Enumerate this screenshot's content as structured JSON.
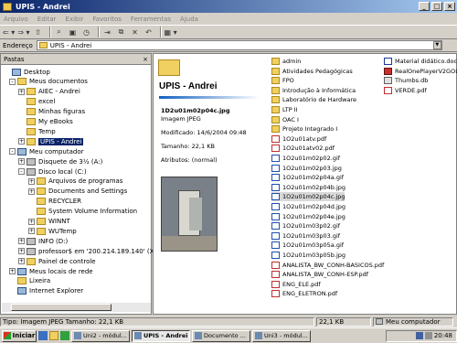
{
  "window": {
    "title": "UPIS - Andrei"
  },
  "menu": [
    "Arquivo",
    "Editar",
    "Exibir",
    "Favoritos",
    "Ferramentas",
    "Ajuda"
  ],
  "address": {
    "label": "Endereço",
    "value": "UPIS - Andrei"
  },
  "folders_pane": {
    "title": "Pastas",
    "close": "×"
  },
  "tree": [
    {
      "label": "Desktop",
      "icon": "desktop-icon",
      "level": 0,
      "expand": ""
    },
    {
      "label": "Meus documentos",
      "icon": "folder-icon",
      "level": 1,
      "expand": "-"
    },
    {
      "label": "AIEC - Andrei",
      "icon": "folder-icon",
      "level": 2,
      "expand": "+"
    },
    {
      "label": "excel",
      "icon": "folder-icon",
      "level": 2,
      "expand": ""
    },
    {
      "label": "Minhas figuras",
      "icon": "folder-icon",
      "level": 2,
      "expand": ""
    },
    {
      "label": "My eBooks",
      "icon": "folder-icon",
      "level": 2,
      "expand": ""
    },
    {
      "label": "Temp",
      "icon": "folder-icon",
      "level": 2,
      "expand": ""
    },
    {
      "label": "UPIS - Andrei",
      "icon": "folder-icon",
      "level": 2,
      "expand": "+",
      "selected": true
    },
    {
      "label": "Meu computador",
      "icon": "computer-icon",
      "level": 1,
      "expand": "-"
    },
    {
      "label": "Disquete de 3½ (A:)",
      "icon": "drive-icon",
      "level": 2,
      "expand": "+"
    },
    {
      "label": "Disco local (C:)",
      "icon": "drive-icon",
      "level": 2,
      "expand": "-"
    },
    {
      "label": "Arquivos de programas",
      "icon": "folder-icon",
      "level": 3,
      "expand": "+"
    },
    {
      "label": "Documents and Settings",
      "icon": "folder-icon",
      "level": 3,
      "expand": "+"
    },
    {
      "label": "RECYCLER",
      "icon": "folder-icon",
      "level": 3,
      "expand": ""
    },
    {
      "label": "System Volume Information",
      "icon": "folder-icon",
      "level": 3,
      "expand": ""
    },
    {
      "label": "WINNT",
      "icon": "folder-icon",
      "level": 3,
      "expand": "+"
    },
    {
      "label": "WUTemp",
      "icon": "folder-icon",
      "level": 3,
      "expand": "+"
    },
    {
      "label": "INFO (D:)",
      "icon": "drive-icon",
      "level": 2,
      "expand": "+"
    },
    {
      "label": "professor$ em '200.214.189.140' (X:)",
      "icon": "drive-icon",
      "level": 2,
      "expand": "+"
    },
    {
      "label": "Painel de controle",
      "icon": "folder-icon",
      "level": 2,
      "expand": "+"
    },
    {
      "label": "Meus locais de rede",
      "icon": "computer-icon",
      "level": 1,
      "expand": "+"
    },
    {
      "label": "Lixeira",
      "icon": "folder-icon",
      "level": 1,
      "expand": ""
    },
    {
      "label": "Internet Explorer",
      "icon": "computer-icon",
      "level": 1,
      "expand": ""
    }
  ],
  "info": {
    "folder_title": "UPIS - Andrei",
    "filename": "1D2u01m02p04c.jpg",
    "filetype": "Imagem JPEG",
    "modified": "Modificado: 14/6/2004 09:48",
    "size": "Tamanho: 22,1 KB",
    "attributes": "Atributos: (normal)"
  },
  "files_col1": [
    {
      "name": "admin",
      "type": "folder"
    },
    {
      "name": "Atividades Pedagógicas",
      "type": "folder"
    },
    {
      "name": "FPO",
      "type": "folder"
    },
    {
      "name": "Introdução à Informática",
      "type": "folder"
    },
    {
      "name": "Laboratório de Hardware",
      "type": "folder"
    },
    {
      "name": "LTP II",
      "type": "folder"
    },
    {
      "name": "OAC I",
      "type": "folder"
    },
    {
      "name": "Projeto Integrado I",
      "type": "folder"
    },
    {
      "name": "1O2u01atv.pdf",
      "type": "pdf"
    },
    {
      "name": "1O2u01atv02.pdf",
      "type": "pdf"
    },
    {
      "name": "1O2u01m02p02.gif",
      "type": "gif"
    },
    {
      "name": "1O2u01m02p03.jpg",
      "type": "gif"
    },
    {
      "name": "1O2u01m02p04a.gif",
      "type": "gif"
    },
    {
      "name": "1O2u01m02p04b.jpg",
      "type": "gif"
    },
    {
      "name": "1O2u01m02p04c.jpg",
      "type": "gif",
      "selected": true
    },
    {
      "name": "1O2u01m02p04d.jpg",
      "type": "gif"
    },
    {
      "name": "1O2u01m02p04e.jpg",
      "type": "gif"
    },
    {
      "name": "1O2u01m03p02.gif",
      "type": "gif"
    },
    {
      "name": "1O2u01m03p03.gif",
      "type": "gif"
    },
    {
      "name": "1O2u01m03p05a.gif",
      "type": "gif"
    },
    {
      "name": "1O2u01m03p05b.jpg",
      "type": "gif"
    },
    {
      "name": "ANALISTA_BW_CONH-BASICOS.pdf",
      "type": "pdf"
    },
    {
      "name": "ANALISTA_BW_CONH-ESP.pdf",
      "type": "pdf"
    },
    {
      "name": "ENG_ELE.pdf",
      "type": "pdf"
    },
    {
      "name": "ENG_ELETRON.pdf",
      "type": "pdf"
    }
  ],
  "files_col2": [
    {
      "name": "Material didático.doc",
      "type": "doc"
    },
    {
      "name": "RealOnePlayerV2GOLD.exe",
      "type": "exe"
    },
    {
      "name": "Thumbs.db",
      "type": "db"
    },
    {
      "name": "VERDE.pdf",
      "type": "pdf"
    }
  ],
  "status": {
    "left": "Tipo: Imagem JPEG Tamanho: 22,1 KB",
    "size": "22,1 KB",
    "location": "Meu computador"
  },
  "taskbar": {
    "start": "Iniciar",
    "tasks": [
      {
        "label": "Uni2 - módul...",
        "active": false
      },
      {
        "label": "UPIS - Andrei",
        "active": true
      },
      {
        "label": "Documento ...",
        "active": false
      },
      {
        "label": "Uni3 - módul...",
        "active": false
      }
    ],
    "clock": "20:48"
  }
}
